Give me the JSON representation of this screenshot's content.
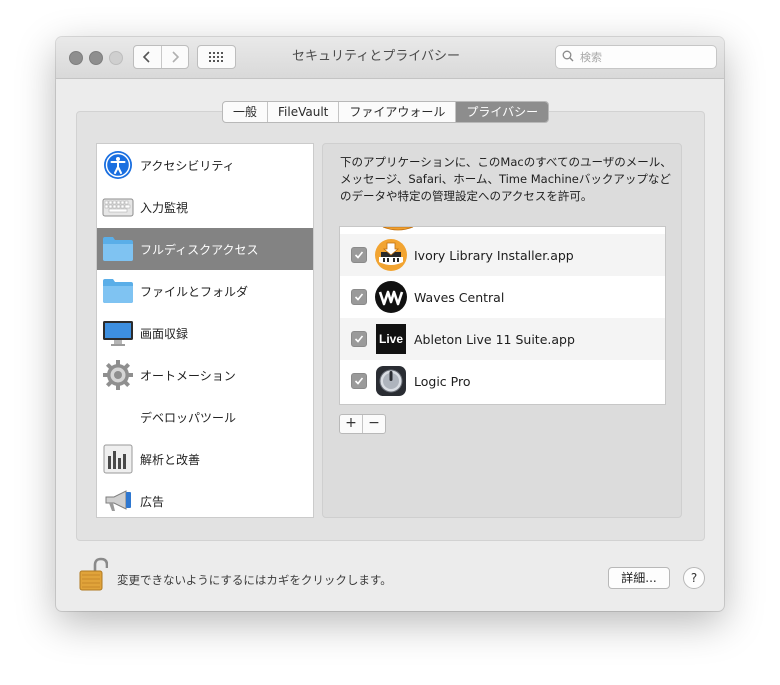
{
  "window": {
    "title": "セキュリティとプライバシー",
    "search_placeholder": "検索"
  },
  "tabs": [
    {
      "label": "一般",
      "active": false
    },
    {
      "label": "FileVault",
      "active": false
    },
    {
      "label": "ファイアウォール",
      "active": false
    },
    {
      "label": "プライバシー",
      "active": true
    }
  ],
  "sidebar": {
    "items": [
      {
        "label": "アクセシビリティ",
        "icon": "accessibility-icon"
      },
      {
        "label": "入力監視",
        "icon": "keyboard-icon"
      },
      {
        "label": "フルディスクアクセス",
        "icon": "folder-icon",
        "selected": true
      },
      {
        "label": "ファイルとフォルダ",
        "icon": "folder-icon"
      },
      {
        "label": "画面収録",
        "icon": "display-icon"
      },
      {
        "label": "オートメーション",
        "icon": "gear-icon"
      },
      {
        "label": "デベロッパツール",
        "icon": ""
      },
      {
        "label": "解析と改善",
        "icon": "bar-chart-icon"
      },
      {
        "label": "広告",
        "icon": "megaphone-icon"
      }
    ]
  },
  "content": {
    "description": "下のアプリケーションに、このMacのすべてのユーザのメール、メッセージ、Safari、ホーム、Time Machineバックアップなどのデータや特定の管理設定へのアクセスを許可。",
    "apps": [
      {
        "name": "Ivory Library Installer.app",
        "checked": true,
        "icon": "ivory-installer-icon"
      },
      {
        "name": "Waves Central",
        "checked": true,
        "icon": "waves-icon"
      },
      {
        "name": "Ableton Live 11 Suite.app",
        "checked": true,
        "icon": "ableton-live-icon",
        "icon_text": "Live"
      },
      {
        "name": "Logic Pro",
        "checked": true,
        "icon": "logic-pro-icon"
      }
    ],
    "add_label": "+",
    "remove_label": "−"
  },
  "footer": {
    "lock_text": "変更できないようにするにはカギをクリックします。",
    "detail_label": "詳細...",
    "help_label": "?"
  }
}
